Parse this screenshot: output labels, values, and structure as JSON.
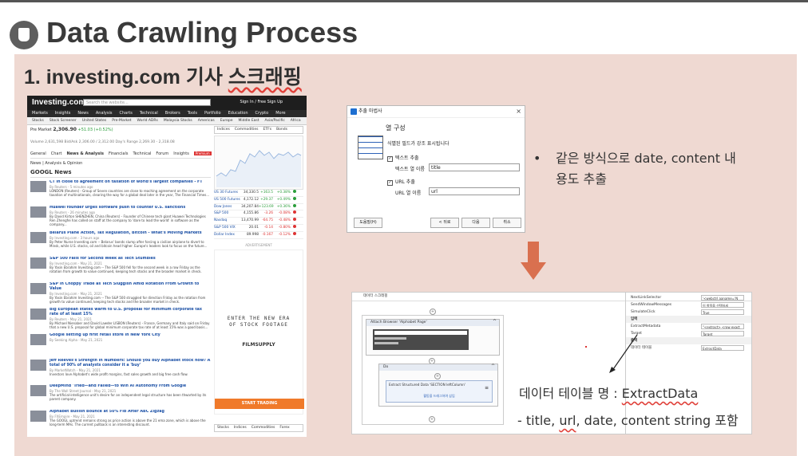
{
  "slide": {
    "title": "Data Crawling Process",
    "subtitle_prefix": "1. investing.com 기사 ",
    "subtitle_keyword": "스크래핑",
    "bullet": "•",
    "bullet_line1": "같은 방식으로 date, content 내",
    "bullet_line2": "용도 추출",
    "table_label": "데이터 테이블 명 : ",
    "table_name": "ExtractData",
    "contains_prefix": "- title, ",
    "contains_url": "url",
    "contains_suffix": ", date, content string 포함",
    "colors": {
      "panel": "#efd9d2",
      "arrow": "#d9704f",
      "accent": "#e0413a"
    }
  },
  "investing": {
    "logo": "Investing.com",
    "search_placeholder": "Search the website...",
    "sign_in": "Sign In / Free Sign Up",
    "nav": [
      "Markets",
      "Insights",
      "News",
      "Analysis",
      "Charts",
      "Technical",
      "Brokers",
      "Tools",
      "Portfolio",
      "Education",
      "Crypto",
      "More"
    ],
    "subnav": [
      "Stocks",
      "Stock Screener",
      "United States",
      "Pre-Market",
      "World ADRs",
      "Malaysia Stocks",
      "Americas",
      "Europe",
      "Middle East",
      "Asia/Pacific",
      "Africa"
    ],
    "premarket_label": "Pre Market",
    "premarket_value": "2,306.90",
    "premarket_change": "+51.03 (+0.52%)",
    "stats_row": "Volume 2,631,598    Bid/Ask 2,306.00 / 2,312.00    Day's Range 2,269.30 - 2,318.08",
    "tabs": [
      "General",
      "Chart",
      "News & Analysis",
      "Financials",
      "Technical",
      "Forum",
      "Insights"
    ],
    "tab_badge": "Premium",
    "news_sub": "News | Analysis & Opinion",
    "news_heading": "GOOGL News",
    "news": [
      {
        "title": "CT in close to agreement on taxation of world's largest companies - FT",
        "meta": "By Reuters - 5 minutes ago",
        "desc": "LONDON (Reuters) - Group of Seven countries are close to reaching agreement on the corporate taxation of multinationals, clearing the way for a global deal later in the year, The Financial Times..."
      },
      {
        "title": "Huawei founder urges software push to counter U.S. sanctions",
        "meta": "By Reuters - 26 minutes ago",
        "desc": "By David Kirton SHENZHEN, China (Reuters) - Founder of Chinese tech giant Huawei Technologies Ren Zhengfei has called on staff at the company to 'dare to lead the world' in software as the company..."
      },
      {
        "title": "Belarus Plane Action, Tax Regulation, Bitcoin - What's Moving Markets",
        "meta": "By Investing.com - 3 hours ago",
        "desc": "By Peter Nurse Investing.com -- Belarus' bonds slump after forcing a civilian airplane to divert to Minsk, while U.S. stocks, oil and bitcoin head higher. Europe's leaders look to focus on the future..."
      },
      {
        "title": "S&P 500 Falls for Second Week as Tech Stumbles",
        "meta": "By Investing.com - May 21, 2021",
        "desc": "By Yasin Ebrahim Investing.com -- The S&P 500 fell for the second week in a row Friday as the rotation from growth to value continued, keeping tech stocks and the broader market in check."
      },
      {
        "title": "S&P in Choppy Trade as Tech Sluggish Amid Rotation From Growth to Value",
        "meta": "By Investing.com - May 21, 2021",
        "desc": "By Yasin Ebrahim Investing.com -- The S&P 500 struggled for direction Friday as the rotation from growth to value continued, keeping tech stocks and the broader market in check."
      },
      {
        "title": "Big European states warm to U.S. proposal for minimum corporate tax rate of at least 15%",
        "meta": "By Reuters - May 21, 2021",
        "desc": "By Michael Nienaber and David Lawder LISBON (Reuters) - France, Germany and Italy said on Friday that a new U.S. proposal for global minimum corporate tax rate of at least 15% was a good basis..."
      },
      {
        "title": "Google setting up first retail store in New York City",
        "meta": "By Seeking Alpha - May 21, 2021",
        "desc": ""
      },
      {
        "title": "Jeff Reeves's Strength in Numbers: Should you buy Alphabet stock now? A total of 90% of analysts consider it a 'buy'",
        "meta": "By MarketWatch - May 21, 2021",
        "desc": "Investors love Alphabet's wide profit margins, fast sales growth and big free cash flow."
      },
      {
        "title": "DeepMind 'Tried—and Failed—to Win AI Autonomy From Google",
        "meta": "By The Wall Street Journal - May 21, 2021",
        "desc": "The artificial-intelligence unit's desire for an independent legal structure has been thwarted by its parent company."
      },
      {
        "title": "Alphabet Bullish Bounce at 50% Fib After ABC Zigzag",
        "meta": "By FXEmpire - May 21, 2021",
        "desc": "The GOOGL uptrend remains strong as price action is above the 21 ema zone, which is above the long-term MAs. The current pullback is an interesting discount."
      }
    ],
    "quote_tabs": [
      "Indices",
      "Commodities",
      "ETFs",
      "Bonds"
    ],
    "quotes": [
      {
        "name": "US 30 Futures",
        "value": "34,330.5",
        "chg": "+163.5",
        "pct": "+0.38%",
        "up": true
      },
      {
        "name": "US 500 Futures",
        "value": "4,172.12",
        "chg": "+29.37",
        "pct": "+0.49%",
        "up": true
      },
      {
        "name": "Dow Jones",
        "value": "34,207.84",
        "chg": "+123.69",
        "pct": "+0.36%",
        "up": true
      },
      {
        "name": "S&P 500",
        "value": "4,155.86",
        "chg": "-3.26",
        "pct": "-0.08%",
        "up": false
      },
      {
        "name": "Nasdaq",
        "value": "13,470.99",
        "chg": "-64.75",
        "pct": "-0.48%",
        "up": false
      },
      {
        "name": "S&P 500 VIX",
        "value": "20.01",
        "chg": "-0.14",
        "pct": "-0.80%",
        "up": false
      },
      {
        "name": "Dollar Index",
        "value": "89.998",
        "chg": "-0.167",
        "pct": "-0.12%",
        "up": false
      }
    ],
    "advertisement": "ADVERTISEMENT",
    "ad_line1": "ENTER THE NEW ERA",
    "ad_line2": "OF STOCK FOOTAGE",
    "ad_brand": "FILMSUPPLY",
    "ad_button": "START TRADING",
    "bottom_tabs": [
      "Stocks",
      "Indices",
      "Commodities",
      "Forex"
    ]
  },
  "dialog": {
    "title": "추출 마법사",
    "heading": "열 구성",
    "desc": "식별된 필드가 강조 표시됩니다",
    "check_text": "텍스트 추출",
    "field_name_label": "텍스트 열 이름",
    "field_name_value": "title",
    "check_url": "URL 추출",
    "url_name_label": "URL 열 이름",
    "url_name_value": "url",
    "btn_help": "도움말(H)",
    "btn_back": "< 뒤로",
    "btn_next": "다음",
    "btn_cancel": "취소"
  },
  "workflow": {
    "panel_title": "데이터 스크래핑",
    "attach_label": "Attach Browser 'Alphabet Page'",
    "do_label": "Do",
    "extract_label": "Extract Structured Data 'SECTION  leftColumn'",
    "drop_hint": "활동을 드래그하여 삽입",
    "props": [
      {
        "key": "NextLinkSelector",
        "value": "'<webctrl aaname='N",
        "cat": false
      },
      {
        "key": "SendWindowMessages",
        "value": "이 항목을 선택하세",
        "cat": false
      },
      {
        "key": "SimulateClick",
        "value": "True",
        "cat": false
      },
      {
        "key": "입력",
        "value": "",
        "cat": true
      },
      {
        "key": "ExtractMetadata",
        "value": "\"<extract> <row exact",
        "cat": false
      },
      {
        "key": "Target",
        "value": "Target",
        "cat": false
      },
      {
        "key": "출력",
        "value": "",
        "cat": true
      },
      {
        "key": "데이터 테이블",
        "value": "ExtractData",
        "cat": false
      }
    ]
  }
}
